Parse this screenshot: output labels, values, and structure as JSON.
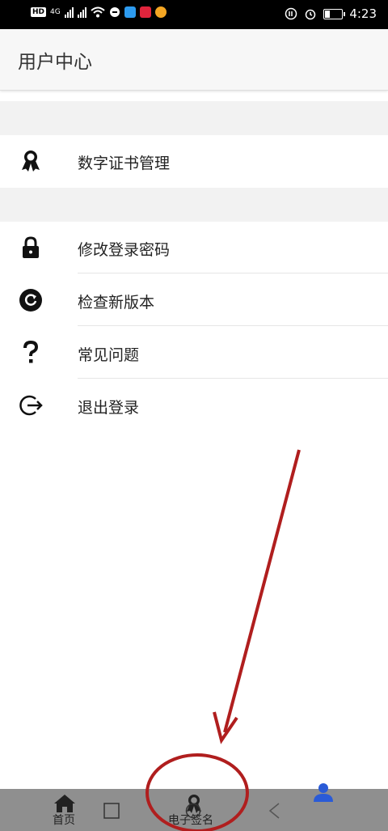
{
  "status_bar": {
    "hd_badge": "HD",
    "network": "4G",
    "time": "4:23"
  },
  "header": {
    "title": "用户中心"
  },
  "menu": {
    "cert": {
      "label": "数字证书管理",
      "icon": "badge-icon"
    },
    "items": [
      {
        "label": "修改登录密码",
        "icon": "lock-icon"
      },
      {
        "label": "检查新版本",
        "icon": "refresh-icon"
      },
      {
        "label": "常见问题",
        "icon": "question-icon"
      },
      {
        "label": "退出登录",
        "icon": "logout-icon"
      }
    ]
  },
  "bottom_nav": {
    "tabs": [
      {
        "label": "首页",
        "icon": "home-icon"
      },
      {
        "label": "电子签名",
        "icon": "badge-icon"
      },
      {
        "label": "",
        "icon": "user-icon",
        "active": true
      }
    ],
    "active_color": "#2a5bd7"
  },
  "annotation": {
    "color": "#b01e1e"
  }
}
